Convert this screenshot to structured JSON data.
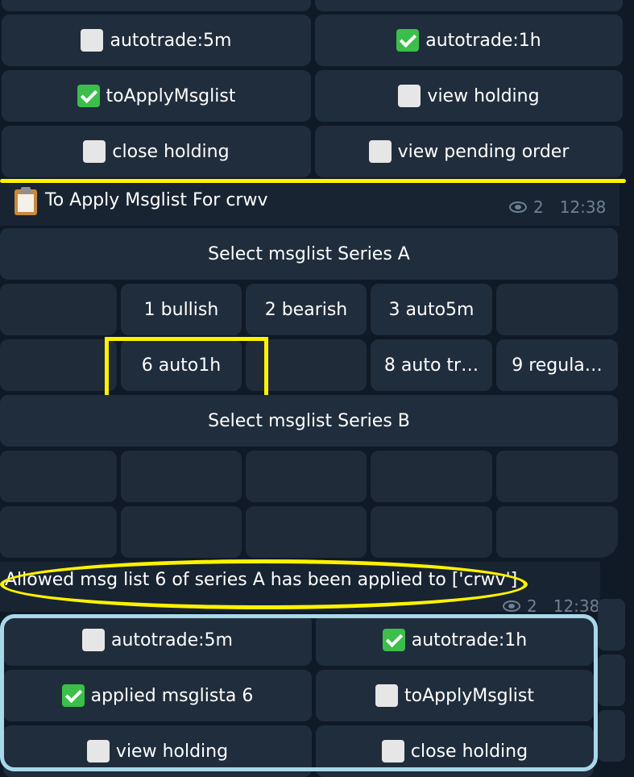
{
  "top_keyboard": {
    "rows": [
      [
        {
          "label": "autotrade:5m",
          "checked": false
        },
        {
          "label": "autotrade:1h",
          "checked": true
        }
      ],
      [
        {
          "label": "toApplyMsglist",
          "checked": true
        },
        {
          "label": "view holding",
          "checked": false
        }
      ],
      [
        {
          "label": "close holding",
          "checked": false
        },
        {
          "label": "view pending order",
          "checked": false
        }
      ]
    ]
  },
  "message1": {
    "icon": "clipboard-icon",
    "text": "To Apply Msglist For crwv",
    "views": "2",
    "time": "12:38"
  },
  "inline_keyboard": {
    "series_a_label": "Select msglist Series A",
    "row1": [
      "",
      "1 bullish",
      "2 bearish",
      "3 auto5m",
      ""
    ],
    "row2": [
      "",
      "6 auto1h",
      "",
      "8 auto tr…",
      "9 regula…"
    ],
    "series_b_label": "Select msglist Series B"
  },
  "message2": {
    "text": "Allowed msg list 6 of series A has been applied to ['crwv']",
    "views": "2",
    "time": "12:38"
  },
  "bottom_keyboard": {
    "rows": [
      [
        {
          "label": "autotrade:5m",
          "checked": false
        },
        {
          "label": "autotrade:1h",
          "checked": true
        }
      ],
      [
        {
          "label": "applied msglista 6",
          "checked": true
        },
        {
          "label": "toApplyMsglist",
          "checked": false
        }
      ],
      [
        {
          "label": "view holding",
          "checked": false
        },
        {
          "label": "close holding",
          "checked": false
        }
      ]
    ]
  },
  "colors": {
    "background": "#0f1a26",
    "button": "#202d3c",
    "highlight_yellow": "#fff200",
    "highlight_blue": "#a8d8ea",
    "check_green": "#3bbf4a"
  }
}
